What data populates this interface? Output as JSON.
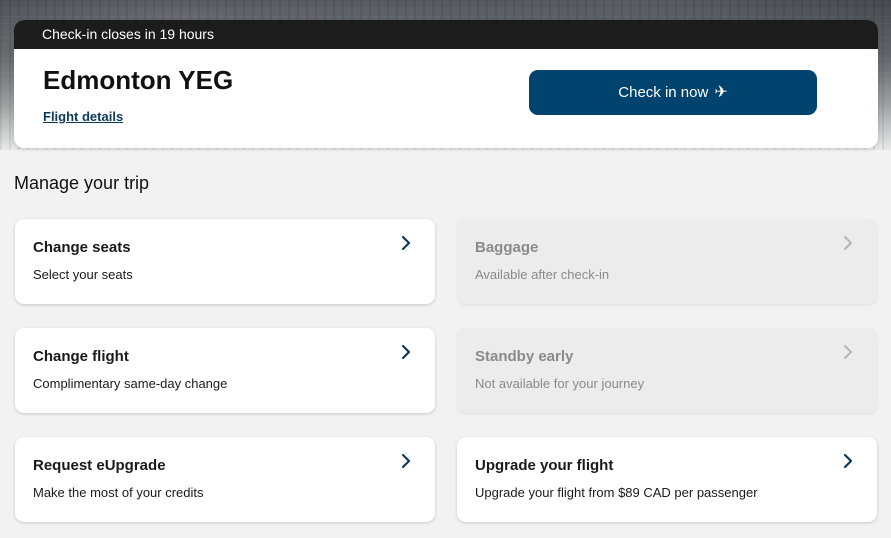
{
  "checkin": {
    "banner_text": "Check-in closes in 19 hours",
    "destination": "Edmonton YEG",
    "flight_details_label": "Flight details",
    "checkin_button_label": "Check in now",
    "plane_icon": "✈"
  },
  "manage": {
    "title": "Manage your trip",
    "tiles": [
      {
        "title": "Change seats",
        "subtitle": "Select your seats"
      },
      {
        "title": "Baggage",
        "subtitle": "Available after check-in"
      },
      {
        "title": "Change flight",
        "subtitle": "Complimentary same-day change"
      },
      {
        "title": "Standby early",
        "subtitle": "Not available for your journey"
      },
      {
        "title": "Request eUpgrade",
        "subtitle": "Make the most of your credits"
      },
      {
        "title": "Upgrade your flight",
        "subtitle": "Upgrade your flight from $89 CAD per passenger"
      }
    ]
  },
  "colors": {
    "primary": "#00436e",
    "chevron_active": "#0b3a5c",
    "chevron_disabled": "#b5b5b5",
    "banner_bg": "#1c1c1c"
  }
}
